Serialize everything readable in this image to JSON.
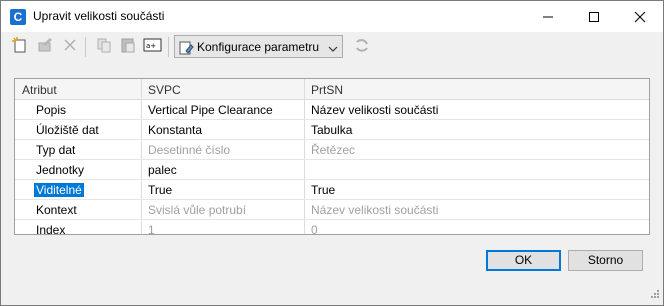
{
  "window": {
    "title": "Upravit velikosti součásti",
    "app_icon_letter": "C"
  },
  "toolbar": {
    "config_label": "Konfigurace parametru"
  },
  "grid": {
    "columns": [
      "Atribut",
      "SVPC",
      "PrtSN"
    ],
    "rows": [
      {
        "attr": "Popis",
        "svpc": "Vertical Pipe Clearance",
        "prtsn": "Název velikosti součásti"
      },
      {
        "attr": "Úložiště dat",
        "svpc": "Konstanta",
        "prtsn": "Tabulka"
      },
      {
        "attr": "Typ dat",
        "svpc": "Desetinné číslo",
        "prtsn": "Řetězec"
      },
      {
        "attr": "Jednotky",
        "svpc": "palec",
        "prtsn": ""
      },
      {
        "attr": "Viditelné",
        "svpc": "True",
        "prtsn": "True"
      },
      {
        "attr": "Kontext",
        "svpc": "Svislá vůle potrubí",
        "prtsn": "Název velikosti součásti"
      },
      {
        "attr": "Index",
        "svpc": "1",
        "prtsn": "0"
      }
    ]
  },
  "buttons": {
    "ok": "OK",
    "cancel": "Storno"
  },
  "colors": {
    "selection": "#0078d7",
    "app_icon": "#1a6fd1"
  }
}
